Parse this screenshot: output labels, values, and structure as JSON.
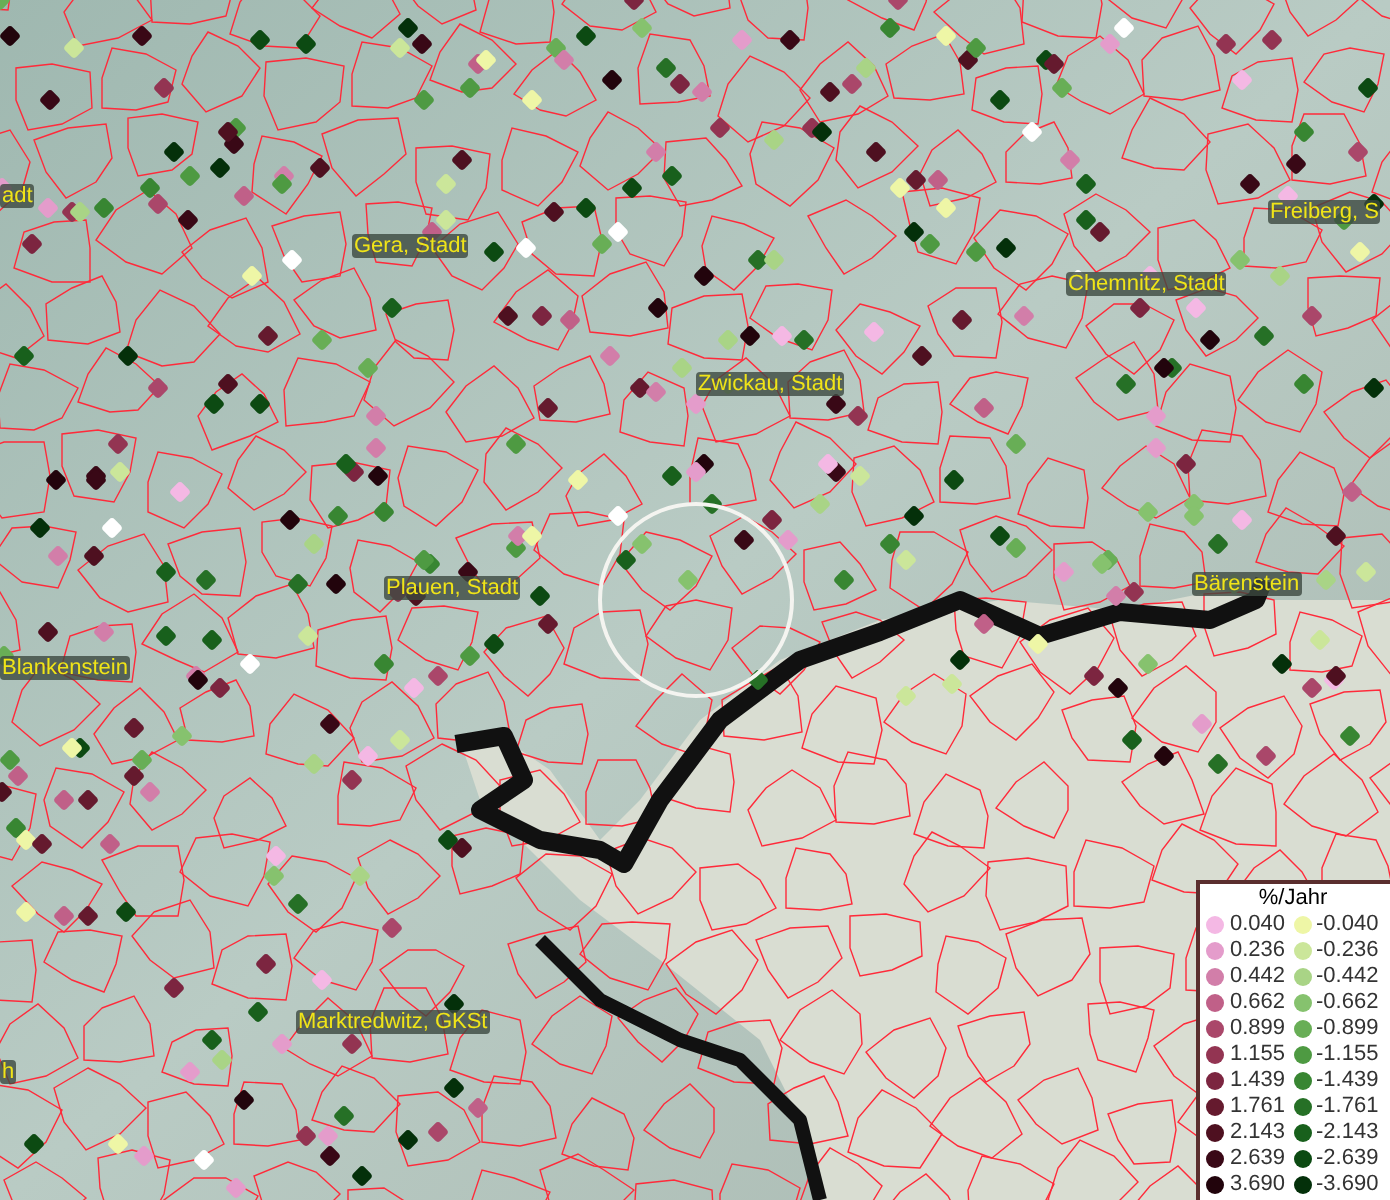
{
  "map": {
    "place_labels": [
      {
        "name": "adt"
      },
      {
        "name": "Gera, Stadt"
      },
      {
        "name": "Freiberg, S"
      },
      {
        "name": "Chemnitz, Stadt"
      },
      {
        "name": "Zwickau, Stadt"
      },
      {
        "name": "Plauen, Stadt"
      },
      {
        "name": "Bärenstein"
      },
      {
        "name": "Blankenstein"
      },
      {
        "name": "Marktredwitz, GKSt"
      },
      {
        "name": "h"
      }
    ]
  },
  "legend": {
    "title": "%/Jahr",
    "rows": [
      {
        "positive": {
          "value": "0.040",
          "color": "#f4b8e4"
        },
        "negative": {
          "value": "-0.040",
          "color": "#eef6a6"
        }
      },
      {
        "positive": {
          "value": "0.236",
          "color": "#e49ccb"
        },
        "negative": {
          "value": "-0.236",
          "color": "#cbe69a"
        }
      },
      {
        "positive": {
          "value": "0.442",
          "color": "#d27ea9"
        },
        "negative": {
          "value": "-0.442",
          "color": "#a9d486"
        }
      },
      {
        "positive": {
          "value": "0.662",
          "color": "#c06088"
        },
        "negative": {
          "value": "-0.662",
          "color": "#86c26e"
        }
      },
      {
        "positive": {
          "value": "0.899",
          "color": "#aa476a"
        },
        "negative": {
          "value": "-0.899",
          "color": "#68ae56"
        }
      },
      {
        "positive": {
          "value": "1.155",
          "color": "#933452"
        },
        "negative": {
          "value": "-1.155",
          "color": "#4e9a42"
        }
      },
      {
        "positive": {
          "value": "1.439",
          "color": "#7c2540"
        },
        "negative": {
          "value": "-1.439",
          "color": "#388632"
        }
      },
      {
        "positive": {
          "value": "1.761",
          "color": "#651a2e"
        },
        "negative": {
          "value": "-1.761",
          "color": "#267026"
        }
      },
      {
        "positive": {
          "value": "2.143",
          "color": "#4e1020"
        },
        "negative": {
          "value": "-2.143",
          "color": "#18601c"
        }
      },
      {
        "positive": {
          "value": "2.639",
          "color": "#390816"
        },
        "negative": {
          "value": "-2.639",
          "color": "#0c4a12"
        }
      },
      {
        "positive": {
          "value": "3.690",
          "color": "#22040c"
        },
        "negative": {
          "value": "-3.690",
          "color": "#04300a"
        }
      }
    ]
  }
}
